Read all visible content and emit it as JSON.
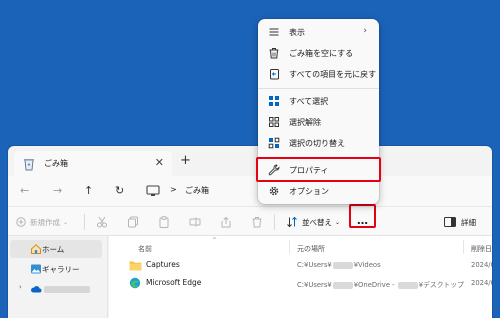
{
  "menu": {
    "items": [
      {
        "label": "表示",
        "icon": "view-icon",
        "submenu": true
      },
      {
        "label": "ごみ箱を空にする",
        "icon": "empty-bin-icon"
      },
      {
        "label": "すべての項目を元に戻す",
        "icon": "restore-all-icon"
      },
      {
        "label": "すべて選択",
        "icon": "select-all-icon"
      },
      {
        "label": "選択解除",
        "icon": "select-none-icon"
      },
      {
        "label": "選択の切り替え",
        "icon": "invert-selection-icon"
      },
      {
        "label": "プロパティ",
        "icon": "wrench-icon"
      },
      {
        "label": "オプション",
        "icon": "gear-icon"
      }
    ]
  },
  "tab": {
    "title": "ごみ箱",
    "close": "✕",
    "add": "+"
  },
  "nav": {
    "back": "←",
    "forward": "→",
    "up": "↑",
    "refresh": "↻",
    "separator": ">",
    "location": "ごみ箱"
  },
  "toolbar": {
    "new_label": "新規作成",
    "sort_label": "並べ替え",
    "more_label": "…",
    "details_label": "詳細"
  },
  "sidebar": {
    "items": [
      {
        "label": "ホーム",
        "icon": "home-icon"
      },
      {
        "label": "ギャラリー",
        "icon": "gallery-icon"
      },
      {
        "label": "",
        "icon": "cloud-icon"
      }
    ]
  },
  "columns": {
    "name": "名前",
    "location": "元の場所",
    "deleted": "削除日"
  },
  "files": [
    {
      "name": "Captures",
      "icon": "folder-icon",
      "loc_prefix": "C:¥Users¥",
      "loc_suffix": "¥Videos",
      "date": "2024/0"
    },
    {
      "name": "Microsoft Edge",
      "icon": "edge-icon",
      "loc_prefix": "C:¥Users¥",
      "loc_mid": "¥OneDrive - ",
      "loc_suffix": "¥デスクトップ",
      "date": "2024/0"
    }
  ],
  "colors": {
    "highlight": "#e60012",
    "desktop": "#1b63b9",
    "accent": "#0067c0"
  }
}
